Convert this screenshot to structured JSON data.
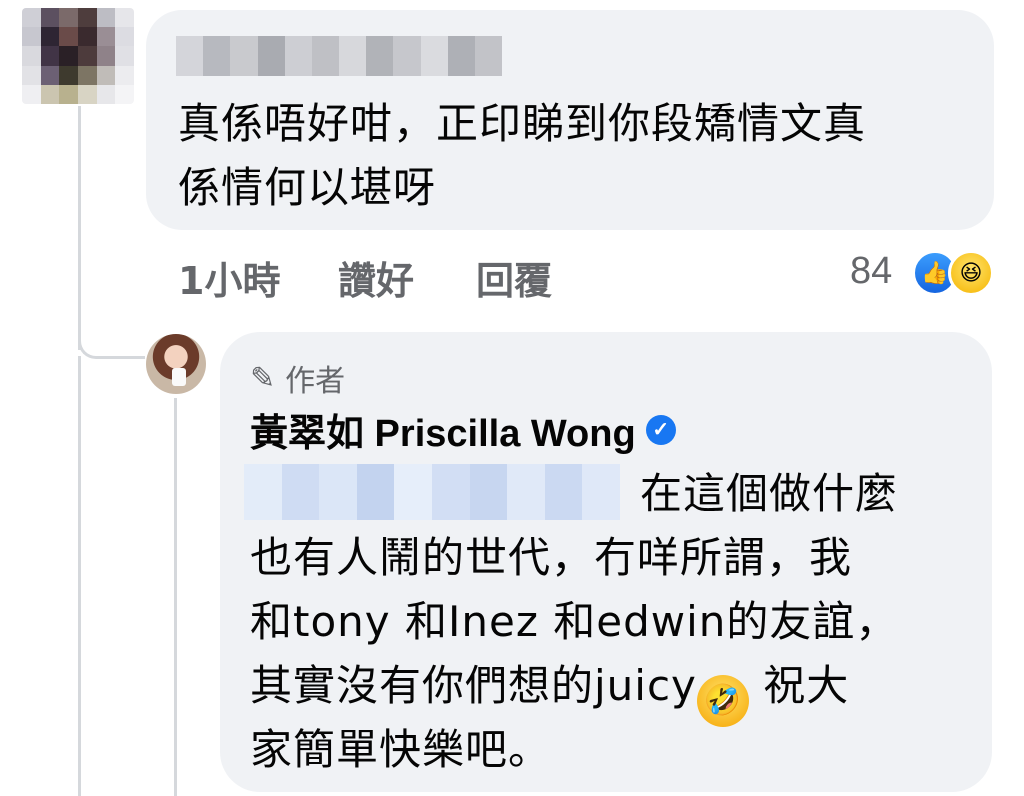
{
  "comment": {
    "text_line1": "真係唔好咁，正印睇到你段矯情文真",
    "text_line2": "係情何以堪呀",
    "actions": {
      "time": "1小時",
      "like": "讚好",
      "reply": "回覆"
    },
    "reaction_count": "84",
    "reactions": [
      "like-icon",
      "haha-icon"
    ]
  },
  "reply": {
    "author_badge": "作者",
    "author_name": "黃翠如 Priscilla Wong",
    "lines": [
      "在這個做什麼",
      "也有人鬧的世代，冇咩所謂，我",
      "和tony 和Inez 和edwin的友誼，",
      "其實沒有你們想的juicy",
      "祝大",
      "家簡單快樂吧。"
    ]
  },
  "colors": {
    "bubble": "#f0f2f5",
    "secondary_text": "#65676b",
    "verified_blue": "#1877f2"
  }
}
